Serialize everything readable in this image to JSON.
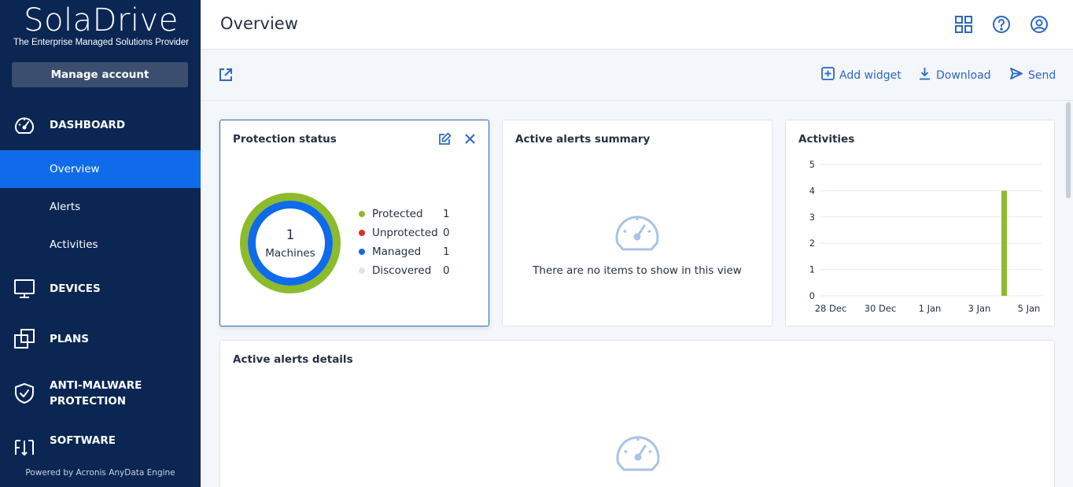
{
  "brand": {
    "logo_text": "SolaDrive",
    "tagline": "The Enterprise Managed Solutions Provider"
  },
  "sidebar": {
    "manage_account": "Manage account",
    "sections": [
      {
        "label": "DASHBOARD",
        "icon": "dashboard-gauge-icon"
      },
      {
        "label": "DEVICES",
        "icon": "monitor-icon"
      },
      {
        "label": "PLANS",
        "icon": "plans-stack-icon"
      },
      {
        "label": "ANTI-MALWARE PROTECTION",
        "icon": "shield-check-icon"
      },
      {
        "label": "SOFTWARE",
        "icon": "software-arrows-icon"
      }
    ],
    "dashboard_items": [
      "Overview",
      "Alerts",
      "Activities"
    ],
    "active_item": "Overview",
    "powered_by": "Powered by Acronis AnyData Engine"
  },
  "header": {
    "title": "Overview",
    "icons": [
      "grid-apps-icon",
      "help-icon",
      "user-account-icon"
    ]
  },
  "toolbar": {
    "add_widget": "Add widget",
    "download": "Download",
    "send": "Send"
  },
  "widgets": {
    "protection_status": {
      "title": "Protection status",
      "total": "1",
      "total_label": "Machines",
      "legend": [
        {
          "label": "Protected",
          "value": "1",
          "color": "#8dbb2c"
        },
        {
          "label": "Unprotected",
          "value": "0",
          "color": "#d93025"
        },
        {
          "label": "Managed",
          "value": "1",
          "color": "#0f6bea"
        },
        {
          "label": "Discovered",
          "value": "0",
          "color": "#dbe3ee"
        }
      ]
    },
    "active_alerts_summary": {
      "title": "Active alerts summary",
      "empty_message": "There are no items to show in this view"
    },
    "activities": {
      "title": "Activities"
    },
    "active_alerts_details": {
      "title": "Active alerts details"
    }
  },
  "chart_data": {
    "type": "bar",
    "x_ticks": [
      "28 Dec",
      "30 Dec",
      "1 Jan",
      "3 Jan",
      "5 Jan"
    ],
    "y_ticks": [
      0,
      1,
      2,
      3,
      4,
      5
    ],
    "ylim": [
      0,
      5
    ],
    "bars": [
      {
        "date": "4 Jan",
        "value": 4
      }
    ],
    "bar_color": "#8dbb2c",
    "grid": true
  },
  "colors": {
    "sidebar_bg": "#0b2653",
    "active_nav": "#0f6bea",
    "accent": "#2a69c0",
    "protected": "#8dbb2c",
    "managed": "#0f6bea"
  }
}
